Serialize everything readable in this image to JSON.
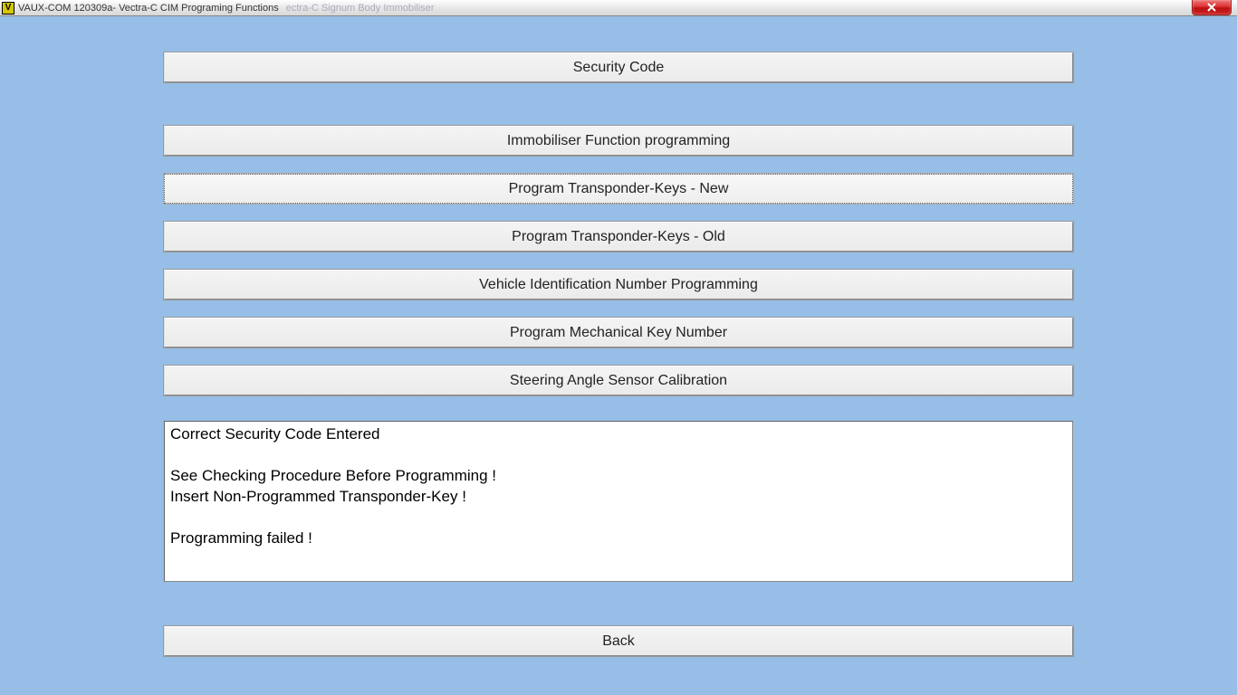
{
  "window": {
    "title": "VAUX-COM 120309a- Vectra-C CIM Programing Functions",
    "ghost_menu": "ectra-C   Signum     Body    Immobiliser"
  },
  "buttons": {
    "security_code": "Security Code",
    "immobiliser_programming": "Immobiliser Function programming",
    "program_keys_new": "Program Transponder-Keys - New",
    "program_keys_old": "Program Transponder-Keys - Old",
    "vin_programming": "Vehicle Identification Number Programming",
    "mech_key_number": "Program Mechanical Key Number",
    "steering_calibration": "Steering Angle Sensor Calibration",
    "back": "Back"
  },
  "log": "Correct Security Code Entered\n\nSee Checking Procedure Before Programming !\nInsert Non-Programmed Transponder-Key !\n\nProgramming failed !"
}
